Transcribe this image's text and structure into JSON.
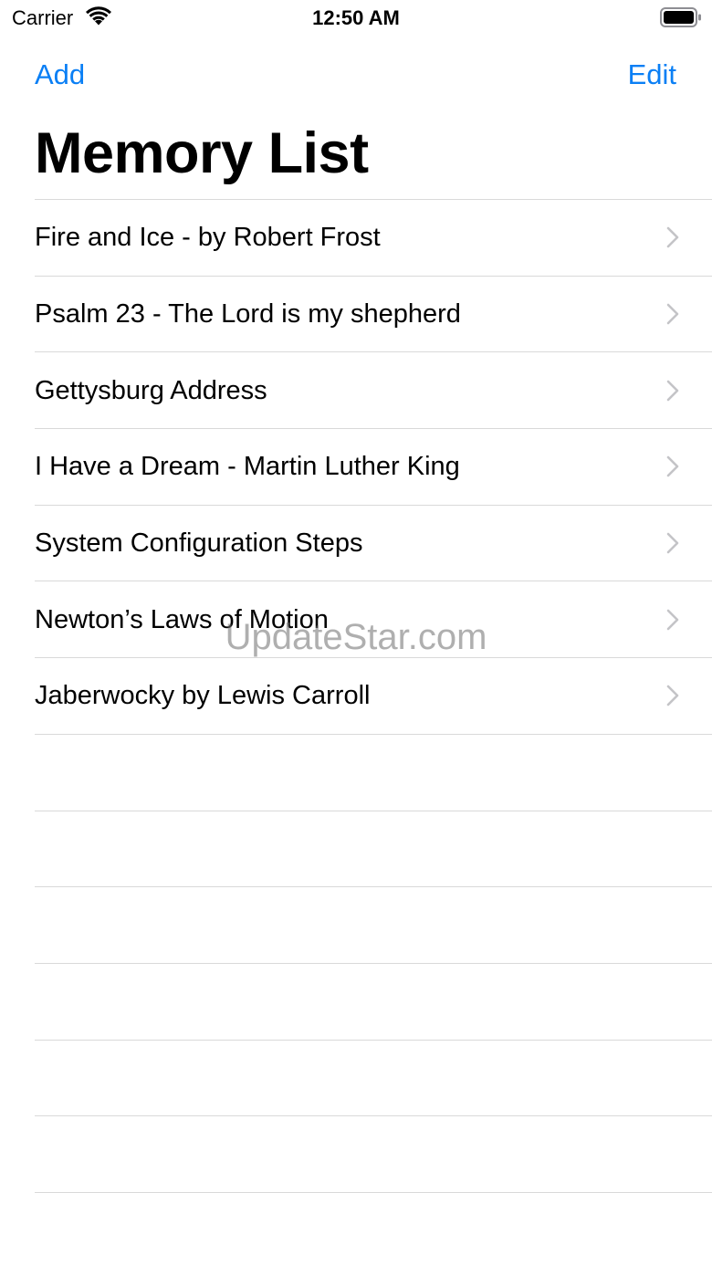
{
  "status_bar": {
    "carrier": "Carrier",
    "time": "12:50 AM",
    "wifi_icon": "wifi-icon",
    "battery_icon": "battery-icon"
  },
  "nav": {
    "add_label": "Add",
    "edit_label": "Edit",
    "accent_color": "#0a7ff5"
  },
  "title": "Memory List",
  "items": [
    {
      "label": "Fire and Ice - by Robert Frost"
    },
    {
      "label": "Psalm 23 - The Lord is my shepherd"
    },
    {
      "label": "Gettysburg Address"
    },
    {
      "label": "I Have a Dream - Martin Luther King"
    },
    {
      "label": "System Configuration Steps"
    },
    {
      "label": "Newton’s Laws of Motion"
    },
    {
      "label": "Jaberwocky by Lewis Carroll"
    }
  ],
  "row_accessory_icon": "chevron-right-icon",
  "watermark": "UpdateStar.com"
}
